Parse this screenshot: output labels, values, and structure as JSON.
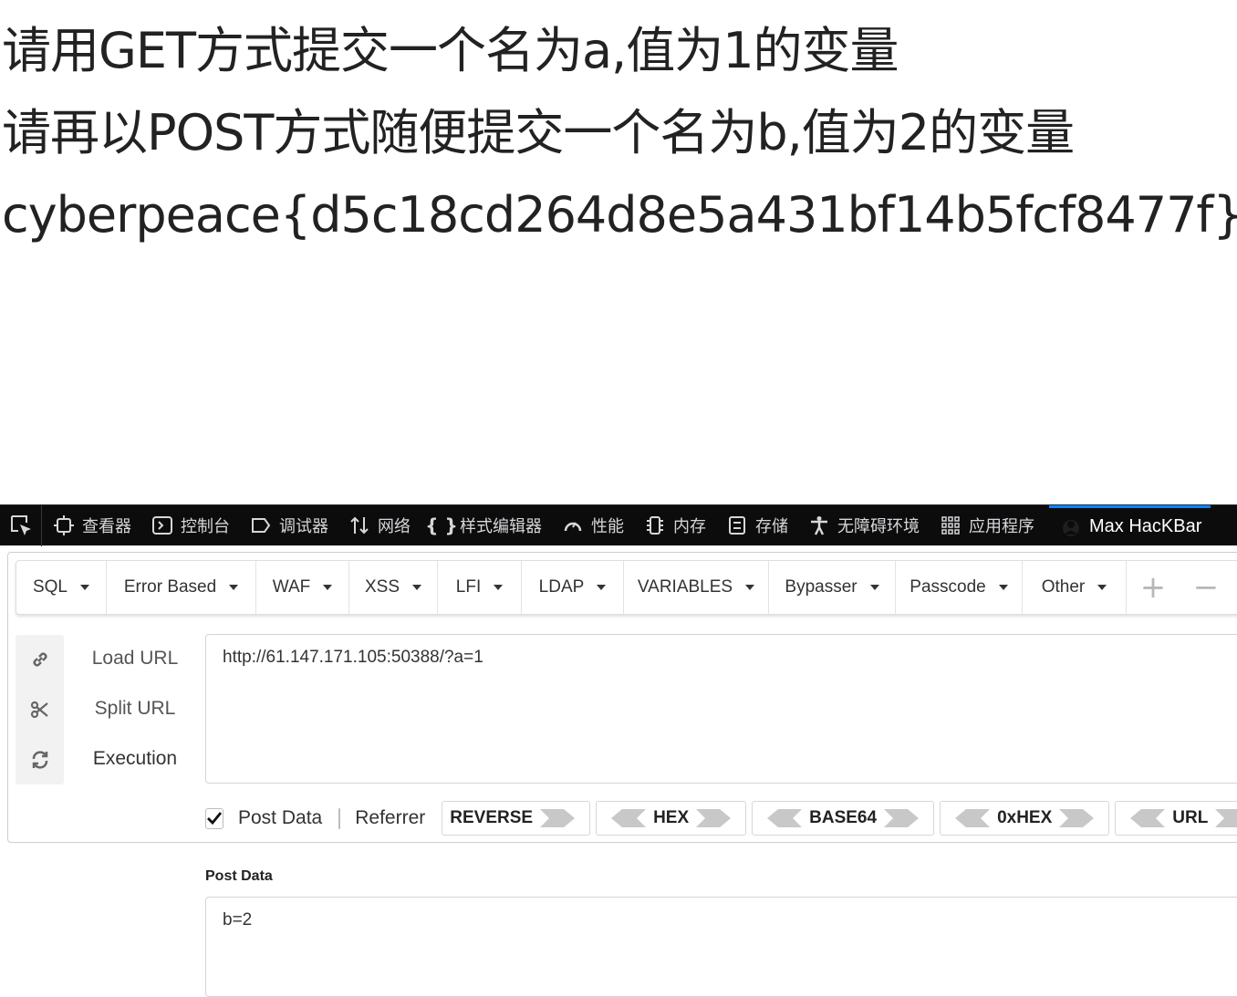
{
  "page": {
    "line1": "请用GET方式提交一个名为a,值为1的变量",
    "line2": "请再以POST方式随便提交一个名为b,值为2的变量",
    "line3": "cyberpeace{d5c18cd264d8e5a431bf14b5fcf8477f}"
  },
  "devtools": {
    "tabs": [
      {
        "label": "查看器",
        "icon": "inspector-icon"
      },
      {
        "label": "控制台",
        "icon": "console-icon"
      },
      {
        "label": "调试器",
        "icon": "debugger-icon"
      },
      {
        "label": "网络",
        "icon": "network-icon"
      },
      {
        "label": "样式编辑器",
        "icon": "style-editor-icon"
      },
      {
        "label": "性能",
        "icon": "performance-icon"
      },
      {
        "label": "内存",
        "icon": "memory-icon"
      },
      {
        "label": "存储",
        "icon": "storage-icon"
      },
      {
        "label": "无障碍环境",
        "icon": "accessibility-icon"
      },
      {
        "label": "应用程序",
        "icon": "application-icon"
      },
      {
        "label": "Max HacKBar",
        "icon": "hackbar-icon",
        "active": true
      }
    ],
    "active_color": "#0a84ff"
  },
  "hackbar": {
    "menu": [
      "SQL",
      "Error Based",
      "WAF",
      "XSS",
      "LFI",
      "LDAP",
      "VARIABLES",
      "Bypasser",
      "Passcode",
      "Other"
    ],
    "plus": "+",
    "minus": "−",
    "actions": {
      "load_url": "Load URL",
      "split_url": "Split URL",
      "execution": "Execution"
    },
    "url_value": "http://61.147.171.105:50388/?a=1",
    "options": {
      "post_data_label": "Post Data",
      "post_data_checked": true,
      "referrer_label": "Referrer",
      "referrer_checked": false
    },
    "encoders": [
      "REVERSE",
      "HEX",
      "BASE64",
      "0xHEX",
      "URL"
    ],
    "post_section_title": "Post Data",
    "post_value": "b=2"
  }
}
